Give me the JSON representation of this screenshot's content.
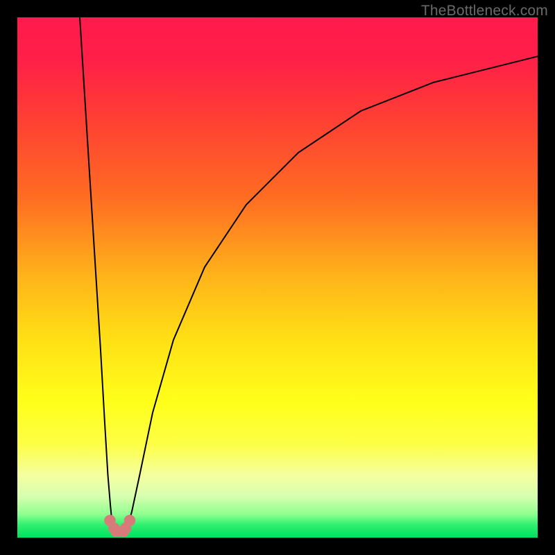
{
  "watermark": "TheBottleneck.com",
  "gradient_stops": [
    {
      "offset": 0.0,
      "color": "#ff1a4d"
    },
    {
      "offset": 0.08,
      "color": "#ff1f48"
    },
    {
      "offset": 0.2,
      "color": "#ff4033"
    },
    {
      "offset": 0.35,
      "color": "#ff6e22"
    },
    {
      "offset": 0.5,
      "color": "#ffb41a"
    },
    {
      "offset": 0.62,
      "color": "#ffe015"
    },
    {
      "offset": 0.74,
      "color": "#ffff1a"
    },
    {
      "offset": 0.82,
      "color": "#fdff45"
    },
    {
      "offset": 0.88,
      "color": "#f5ffa0"
    },
    {
      "offset": 0.92,
      "color": "#d8ffb0"
    },
    {
      "offset": 0.955,
      "color": "#90ff90"
    },
    {
      "offset": 0.975,
      "color": "#30f070"
    },
    {
      "offset": 1.0,
      "color": "#00e060"
    }
  ],
  "chart_data": {
    "type": "line",
    "title": "",
    "xlabel": "",
    "ylabel": "",
    "xlim": [
      0,
      100
    ],
    "ylim": [
      0,
      100
    ],
    "grid": false,
    "series": [
      {
        "name": "left-branch",
        "x": [
          12.0,
          13.0,
          14.0,
          15.0,
          16.0,
          16.8,
          17.4,
          17.9,
          18.2,
          18.5
        ],
        "values": [
          100.0,
          84.0,
          68.0,
          52.0,
          36.0,
          22.0,
          12.0,
          6.0,
          3.0,
          1.4
        ]
      },
      {
        "name": "right-branch",
        "x": [
          21.0,
          22.0,
          23.5,
          26.0,
          30.0,
          36.0,
          44.0,
          54.0,
          66.0,
          80.0,
          100.0
        ],
        "values": [
          1.4,
          5.0,
          12.0,
          24.0,
          38.0,
          52.0,
          64.0,
          74.0,
          82.0,
          87.5,
          92.5
        ]
      }
    ],
    "markers": [
      {
        "name": "dot-left",
        "x": 17.8,
        "y": 3.3,
        "color": "#d97a7a",
        "r": 1.1
      },
      {
        "name": "dot-mid-left",
        "x": 18.6,
        "y": 1.8,
        "color": "#d97a7a",
        "r": 1.1
      },
      {
        "name": "dot-bottom-left",
        "x": 19.0,
        "y": 1.2,
        "color": "#d97a7a",
        "r": 1.1
      },
      {
        "name": "dot-bottom-right",
        "x": 20.4,
        "y": 1.2,
        "color": "#d97a7a",
        "r": 1.1
      },
      {
        "name": "dot-mid-right",
        "x": 20.8,
        "y": 1.8,
        "color": "#d97a7a",
        "r": 1.1
      },
      {
        "name": "dot-right",
        "x": 21.6,
        "y": 3.3,
        "color": "#d97a7a",
        "r": 1.1
      }
    ],
    "curve_color": "#000000",
    "curve_width": 2
  }
}
